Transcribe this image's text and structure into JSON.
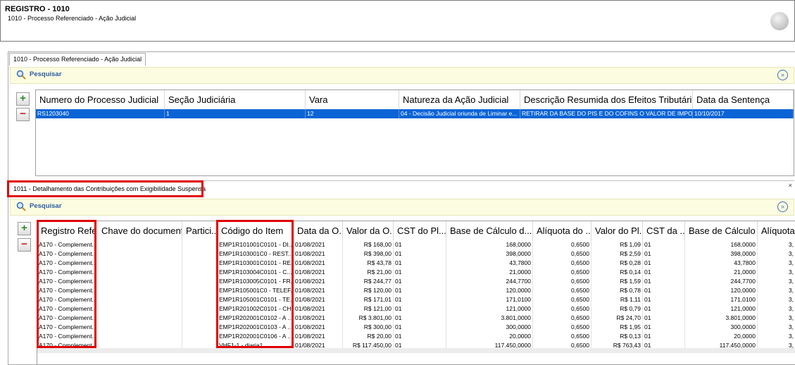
{
  "header": {
    "title": "REGISTRO - 1010",
    "subtitle": "1010 - Processo Referenciado - Ação Judicial"
  },
  "tab": {
    "label": "1010 - Processo Referenciado - Ação Judicial"
  },
  "search1": {
    "label": "Pesquisar"
  },
  "search2": {
    "label": "Pesquisar"
  },
  "grid1": {
    "columns": [
      "Numero do Processo Judicial",
      "Seção Judiciária",
      "Vara",
      "Natureza da Ação Judicial",
      "Descrição Resumida dos Efeitos Tributários",
      "Data da Sentença"
    ],
    "row": [
      "RS1203040",
      "1",
      "12",
      "04 - Decisão Judicial oriunda de Liminar e...",
      "RETIRAR DA BASE DO PIS E DO COFINS O VALOR DE IMPO...",
      "10/10/2017"
    ]
  },
  "section2": {
    "label": "1011 - Detalhamento das Contribuições com Exigibilidade Suspensa",
    "close": "×"
  },
  "grid2": {
    "columns": [
      "Registro Refe...",
      "Chave do document...",
      "Partici...",
      "Código do Item",
      "Data da O...",
      "Valor da O...",
      "CST do Pl...",
      "Base de Cálculo d...",
      "Alíquota do ...",
      "Valor do Pl...",
      "CST da ...",
      "Base de Cálculo ...",
      "Alíquota"
    ],
    "rows": [
      [
        "A170 - Complement...",
        "",
        "",
        "EMP1R101001C0101 - DI...",
        "01/08/2021",
        "R$ 168,00",
        "01",
        "168,0000",
        "0,6500",
        "R$ 1,09",
        "01",
        "168,0000",
        "3,"
      ],
      [
        "A170 - Complement...",
        "",
        "",
        "EMP1R103001C0 - REST...",
        "01/08/2021",
        "R$ 398,00",
        "01",
        "398,0000",
        "0,6500",
        "R$ 2,59",
        "01",
        "398,0000",
        "3,"
      ],
      [
        "A170 - Complement...",
        "",
        "",
        "EMP1R103001C0101 - RE...",
        "01/08/2021",
        "R$ 43,78",
        "01",
        "43,7800",
        "0,6500",
        "R$ 0,28",
        "01",
        "43,7800",
        "3,"
      ],
      [
        "A170 - Complement...",
        "",
        "",
        "EMP1R103004C0101 - C...",
        "01/08/2021",
        "R$ 21,00",
        "01",
        "21,0000",
        "0,6500",
        "R$ 0,14",
        "01",
        "21,0000",
        "3,"
      ],
      [
        "A170 - Complement...",
        "",
        "",
        "EMP1R103005C0101 - FR...",
        "01/08/2021",
        "R$ 244,77",
        "01",
        "244,7700",
        "0,6500",
        "R$ 1,59",
        "01",
        "244,7700",
        "3,"
      ],
      [
        "A170 - Complement...",
        "",
        "",
        "EMP1R105001C0 - TELEF...",
        "01/08/2021",
        "R$ 120,00",
        "01",
        "120,0000",
        "0,6500",
        "R$ 0,78",
        "01",
        "120,0000",
        "3,"
      ],
      [
        "A170 - Complement...",
        "",
        "",
        "EMP1R105001C0101 - TE...",
        "01/08/2021",
        "R$ 171,01",
        "01",
        "171,0100",
        "0,6500",
        "R$ 1,11",
        "01",
        "171,0100",
        "3,"
      ],
      [
        "A170 - Complement...",
        "",
        "",
        "EMP1R201002C0101 - CH...",
        "01/08/2021",
        "R$ 121,00",
        "01",
        "121,0000",
        "0,6500",
        "R$ 0,79",
        "01",
        "121,0000",
        "3,"
      ],
      [
        "A170 - Complement...",
        "",
        "",
        "EMP1R202001C0102 - A ...",
        "01/08/2021",
        "R$ 3.801,00",
        "01",
        "3.801,0000",
        "0,6500",
        "R$ 24,70",
        "01",
        "3.801,0000",
        "3,"
      ],
      [
        "A170 - Complement...",
        "",
        "",
        "EMP1R202001C0103 - A ...",
        "01/08/2021",
        "R$ 300,00",
        "01",
        "300,0000",
        "0,6500",
        "R$ 1,95",
        "01",
        "300,0000",
        "3,"
      ],
      [
        "A170 - Complement...",
        "",
        "",
        "EMP1R202001C0106 - A ...",
        "01/08/2021",
        "R$ 20,00",
        "01",
        "20,0000",
        "0,6500",
        "R$ 0,13",
        "01",
        "20,0000",
        "3,"
      ],
      [
        "A170 - Complement...",
        "",
        "",
        "VHF1-1 - diaria1",
        "01/08/2021",
        "R$ 117.450,00",
        "01",
        "117.450,0000",
        "0,6500",
        "R$ 763,43",
        "01",
        "117.450,0000",
        "3,"
      ]
    ]
  },
  "colors": {
    "selection": "#0a64d6",
    "highlight": "#e00000",
    "search_bg": "#fcfce0",
    "search_text": "#2b5aa3"
  },
  "icons": {
    "search": "magnifier-icon",
    "expand": "double-chevron-down-icon",
    "add": "plus-icon",
    "remove": "minus-icon",
    "logo": "app-logo-icon",
    "close": "close-icon"
  }
}
